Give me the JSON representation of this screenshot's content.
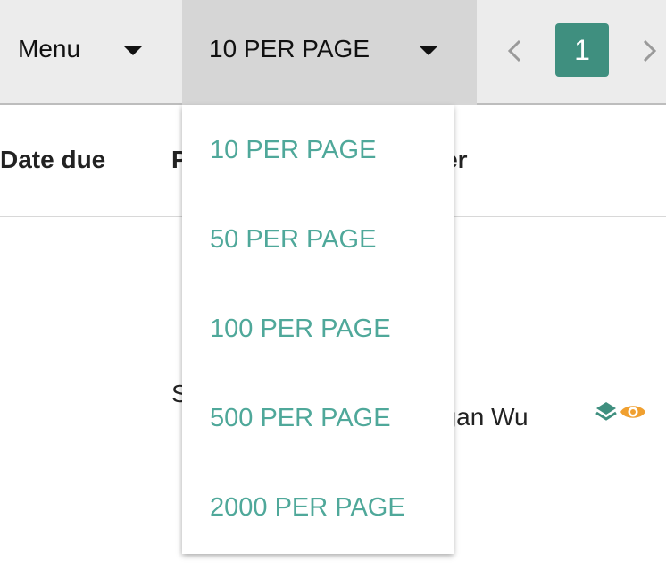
{
  "toolbar": {
    "menu_label": "Menu",
    "per_page_label": "10 PER PAGE",
    "pager": {
      "prev_icon": "chevron-left-icon",
      "current_page": "1",
      "next_icon": "chevron-right-icon"
    }
  },
  "table": {
    "headers": {
      "date_due": "Date due",
      "second_col_fragment": "P",
      "owner_fragment": "ner"
    },
    "rows": [
      {
        "col2_fragment": "S",
        "owner_fragment": "ggan Wu",
        "icons": [
          "layers-icon",
          "eye-icon"
        ]
      }
    ]
  },
  "per_page_menu": {
    "items": [
      "10 PER PAGE",
      "50 PER PAGE",
      "100 PER PAGE",
      "500 PER PAGE",
      "2000 PER PAGE"
    ]
  },
  "colors": {
    "accent": "#3f8f7f",
    "menu_item_text": "#4fa89a",
    "eye_icon": "#f0a030",
    "layers_icon": "#3f8f7f"
  }
}
